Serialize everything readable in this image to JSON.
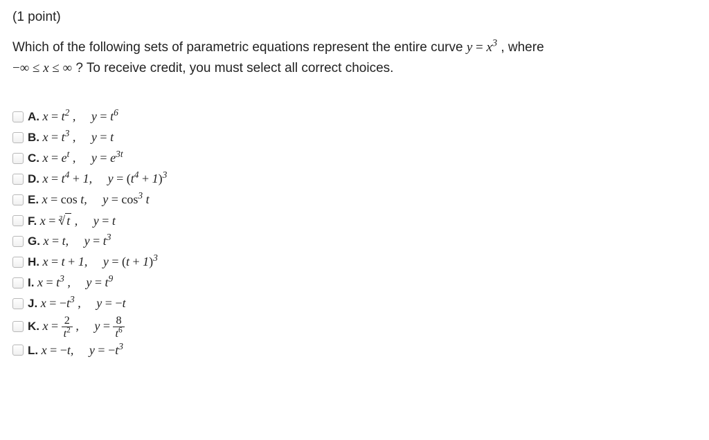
{
  "points_label": "(1 point)",
  "question_html": "Which of the following sets of parametric equations represent the entire curve <span class='math'>y <span class='mathop'>=</span> x<span class='sup'>3</span></span> , where <br><span class='math'><span class='mathop'>−</span><span class='inf'>∞</span> <span class='mathop'>≤</span> x <span class='mathop'>≤</span> <span class='inf'>∞</span></span> ? To receive credit, you must select all correct choices.",
  "choices": [
    {
      "letter": "A.",
      "html": "<span class='math'>x <span class='mathop'>=</span> t<span class='sup'>2</span> , &nbsp;&nbsp;&nbsp; y <span class='mathop'>=</span> t<span class='sup'>6</span></span>"
    },
    {
      "letter": "B.",
      "html": "<span class='math'>x <span class='mathop'>=</span> t<span class='sup'>3</span> , &nbsp;&nbsp;&nbsp; y <span class='mathop'>=</span> t</span>"
    },
    {
      "letter": "C.",
      "html": "<span class='math'>x <span class='mathop'>=</span> e<span class='sup'>t</span> , &nbsp;&nbsp;&nbsp; y <span class='mathop'>=</span> e<span class='sup'>3t</span></span>"
    },
    {
      "letter": "D.",
      "html": "<span class='math'>x <span class='mathop'>=</span> t<span class='sup'>4</span> <span class='mathop'>+</span> 1, &nbsp;&nbsp;&nbsp; y <span class='mathop'>=</span> <span class='mathop'>(</span>t<span class='sup'>4</span> <span class='mathop'>+</span> 1<span class='mathop'>)</span><span class='sup'>3</span></span>"
    },
    {
      "letter": "E.",
      "html": "<span class='math'>x <span class='mathop'>= cos</span> t, &nbsp;&nbsp;&nbsp; y <span class='mathop'>= cos</span><span class='sup'>3</span> t</span>"
    },
    {
      "letter": "F.",
      "html": "<span class='math'>x <span class='mathop'>=</span> <span class='root'><span class='root-index'>3</span><span class='mathop'>√</span><span class='radicand'>t</span></span> , &nbsp;&nbsp;&nbsp; y <span class='mathop'>=</span> t</span>"
    },
    {
      "letter": "G.",
      "html": "<span class='math'>x <span class='mathop'>=</span> t, &nbsp;&nbsp;&nbsp; y <span class='mathop'>=</span> t<span class='sup'>3</span></span>"
    },
    {
      "letter": "H.",
      "html": "<span class='math'>x <span class='mathop'>=</span> t <span class='mathop'>+</span> 1, &nbsp;&nbsp;&nbsp; y <span class='mathop'>=</span> <span class='mathop'>(</span>t <span class='mathop'>+</span> 1<span class='mathop'>)</span><span class='sup'>3</span></span>"
    },
    {
      "letter": "I.",
      "html": "<span class='math'>x <span class='mathop'>=</span> t<span class='sup'>3</span> , &nbsp;&nbsp;&nbsp; y <span class='mathop'>=</span> t<span class='sup'>9</span></span>"
    },
    {
      "letter": "J.",
      "html": "<span class='math'>x <span class='mathop'>= −</span>t<span class='sup'>3</span> , &nbsp;&nbsp;&nbsp; y <span class='mathop'>= −</span>t</span>"
    },
    {
      "letter": "K.",
      "html": "<span class='math'>x <span class='mathop'>=</span> <span class='frac'><span class='num'><span class='mathop'>2</span></span><span class='den'>t<span class='sup mathop' style='font-size:0.7em'>2</span></span></span> , &nbsp;&nbsp;&nbsp; y <span class='mathop'>=</span> <span class='frac'><span class='num'><span class='mathop'>8</span></span><span class='den'>t<span class='sup mathop' style='font-size:0.7em'>6</span></span></span></span>"
    },
    {
      "letter": "L.",
      "html": "<span class='math'>x <span class='mathop'>= −</span>t, &nbsp;&nbsp;&nbsp; y <span class='mathop'>= −</span>t<span class='sup'>3</span></span>"
    }
  ]
}
